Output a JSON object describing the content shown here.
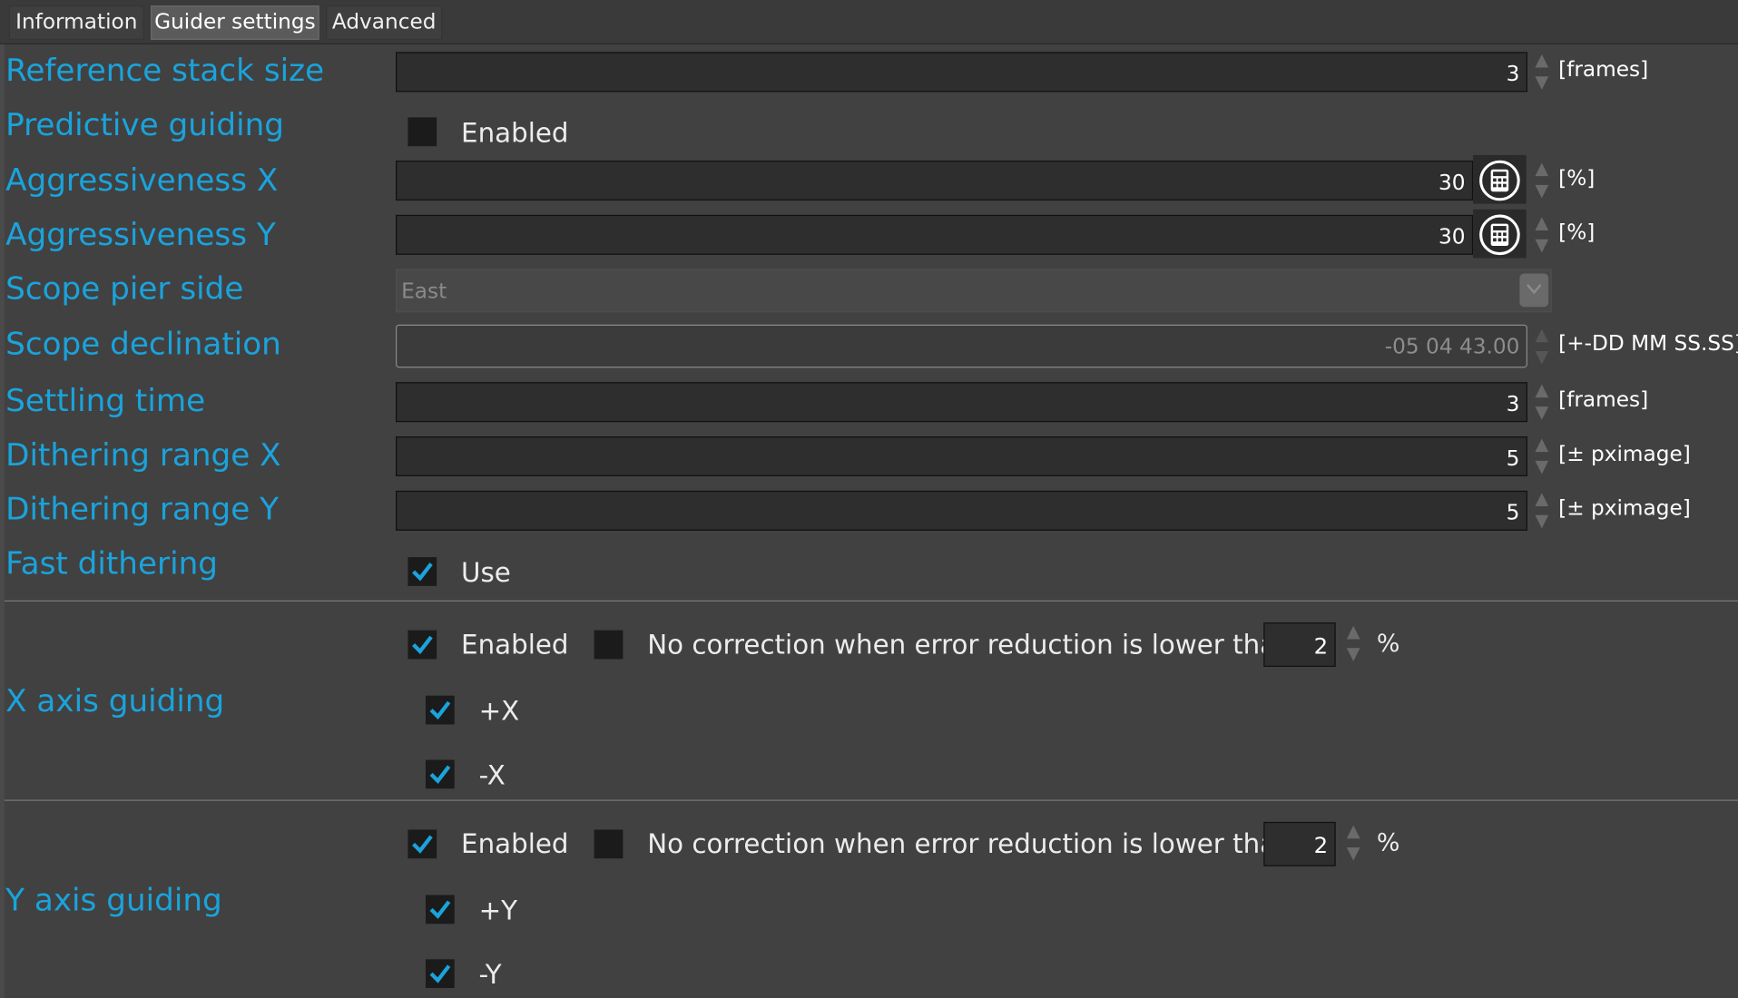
{
  "tabs": [
    {
      "label": "Information",
      "active": false
    },
    {
      "label": "Guider settings",
      "active": true
    },
    {
      "label": "Advanced",
      "active": false
    }
  ],
  "reference_stack_size": {
    "label": "Reference stack size",
    "value": "3",
    "unit": "[frames]"
  },
  "predictive_guiding": {
    "label": "Predictive guiding",
    "checkbox_label": "Enabled",
    "checked": false
  },
  "aggressiveness_x": {
    "label": "Aggressiveness X",
    "value": "30",
    "unit": "[%]",
    "icon": "calculator-icon"
  },
  "aggressiveness_y": {
    "label": "Aggressiveness Y",
    "value": "30",
    "unit": "[%]",
    "icon": "calculator-icon"
  },
  "scope_pier_side": {
    "label": "Scope pier side",
    "value": "East"
  },
  "scope_declination": {
    "label": "Scope declination",
    "value": "-05 04 43.00",
    "unit": "[+-DD MM SS.SS]"
  },
  "settling_time": {
    "label": "Settling time",
    "value": "3",
    "unit": "[frames]"
  },
  "dithering_range_x": {
    "label": "Dithering range X",
    "value": "5",
    "unit": "[± pximage]"
  },
  "dithering_range_y": {
    "label": "Dithering range Y",
    "value": "5",
    "unit": "[± pximage]"
  },
  "fast_dithering": {
    "label": "Fast dithering",
    "checkbox_label": "Use",
    "checked": true
  },
  "x_axis_guiding": {
    "label": "X axis guiding",
    "enabled_label": "Enabled",
    "enabled": true,
    "no_correction_label": "No correction when error reduction is lower than",
    "no_correction": false,
    "threshold": "2",
    "threshold_unit": "%",
    "plus_label": "+X",
    "plus": true,
    "minus_label": "-X",
    "minus": true
  },
  "y_axis_guiding": {
    "label": "Y axis guiding",
    "enabled_label": "Enabled",
    "enabled": true,
    "no_correction_label": "No correction when error reduction is lower than",
    "no_correction": false,
    "threshold": "2",
    "threshold_unit": "%",
    "plus_label": "+Y",
    "plus": true,
    "minus_label": "-Y",
    "minus": true
  },
  "colors": {
    "accent_label": "#1aa3dc",
    "check": "#1aa3dc",
    "background": "#414141"
  }
}
